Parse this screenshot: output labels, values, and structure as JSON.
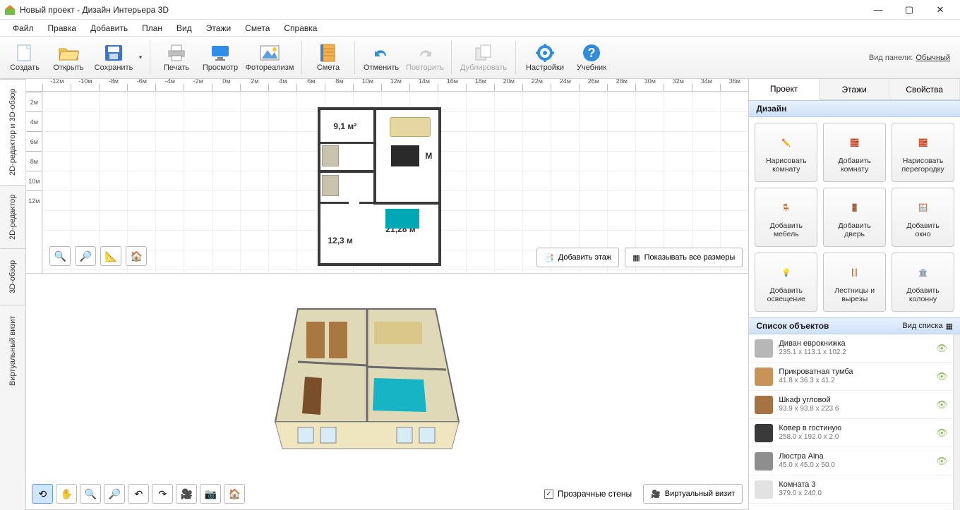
{
  "title": "Новый проект - Дизайн Интерьера 3D",
  "menu": {
    "items": [
      "Файл",
      "Правка",
      "Добавить",
      "План",
      "Вид",
      "Этажи",
      "Смета",
      "Справка"
    ]
  },
  "toolbar": {
    "create": "Создать",
    "open": "Открыть",
    "save": "Сохранить",
    "print": "Печать",
    "preview": "Просмотр",
    "photoreal": "Фотореализм",
    "estimate": "Смета",
    "undo": "Отменить",
    "redo": "Повторить",
    "duplicate": "Дублировать",
    "settings": "Настройки",
    "tutorial": "Учебник",
    "panel_label": "Вид панели:",
    "panel_mode": "Обычный"
  },
  "left_tabs": [
    "2D-редактор и 3D-обзор",
    "2D-редактор",
    "3D-обзор",
    "Виртуальный визит"
  ],
  "ruler_h": [
    "-12м",
    "-10м",
    "-8м",
    "-6м",
    "-4м",
    "-2м",
    "0м",
    "2м",
    "4м",
    "6м",
    "8м",
    "10м",
    "12м",
    "14м",
    "16м",
    "18м",
    "20м",
    "22м",
    "24м",
    "26м",
    "28м",
    "30м",
    "32м",
    "34м",
    "36м"
  ],
  "ruler_v": [
    "2м",
    "4м",
    "6м",
    "8м",
    "10м",
    "12м"
  ],
  "floorplan": {
    "room1": "9,1 м²",
    "room2": "12,3 м",
    "room3": "21,28 м",
    "mark_m": "М"
  },
  "canvas2d": {
    "add_floor": "Добавить этаж",
    "show_sizes": "Показывать все размеры"
  },
  "canvas3d": {
    "transparent": "Прозрачные стены",
    "virtual": "Виртуальный визит"
  },
  "right_tabs": {
    "project": "Проект",
    "floors": "Этажи",
    "properties": "Свойства"
  },
  "design_hdr": "Дизайн",
  "design_buttons": [
    {
      "l1": "Нарисовать",
      "l2": "комнату"
    },
    {
      "l1": "Добавить",
      "l2": "комнату"
    },
    {
      "l1": "Нарисовать",
      "l2": "перегородку"
    },
    {
      "l1": "Добавить",
      "l2": "мебель"
    },
    {
      "l1": "Добавить",
      "l2": "дверь"
    },
    {
      "l1": "Добавить",
      "l2": "окно"
    },
    {
      "l1": "Добавить",
      "l2": "освещение"
    },
    {
      "l1": "Лестницы и",
      "l2": "вырезы"
    },
    {
      "l1": "Добавить",
      "l2": "колонну"
    }
  ],
  "objects_hdr": "Список объектов",
  "objects_view": "Вид списка",
  "objects": [
    {
      "name": "Диван еврокнижка",
      "dims": "235.1 x 113.1 x 102.2"
    },
    {
      "name": "Прикроватная тумба",
      "dims": "41.8 x 36.3 x 41.2"
    },
    {
      "name": "Шкаф угловой",
      "dims": "93.9 x 93.8 x 223.6"
    },
    {
      "name": "Ковер в гостиную",
      "dims": "258.0 x 192.0 x 2.0"
    },
    {
      "name": "Люстра Aina",
      "dims": "45.0 x 45.0 x 50.0"
    },
    {
      "name": "Комната 3",
      "dims": "379.0 x 240.0"
    }
  ]
}
